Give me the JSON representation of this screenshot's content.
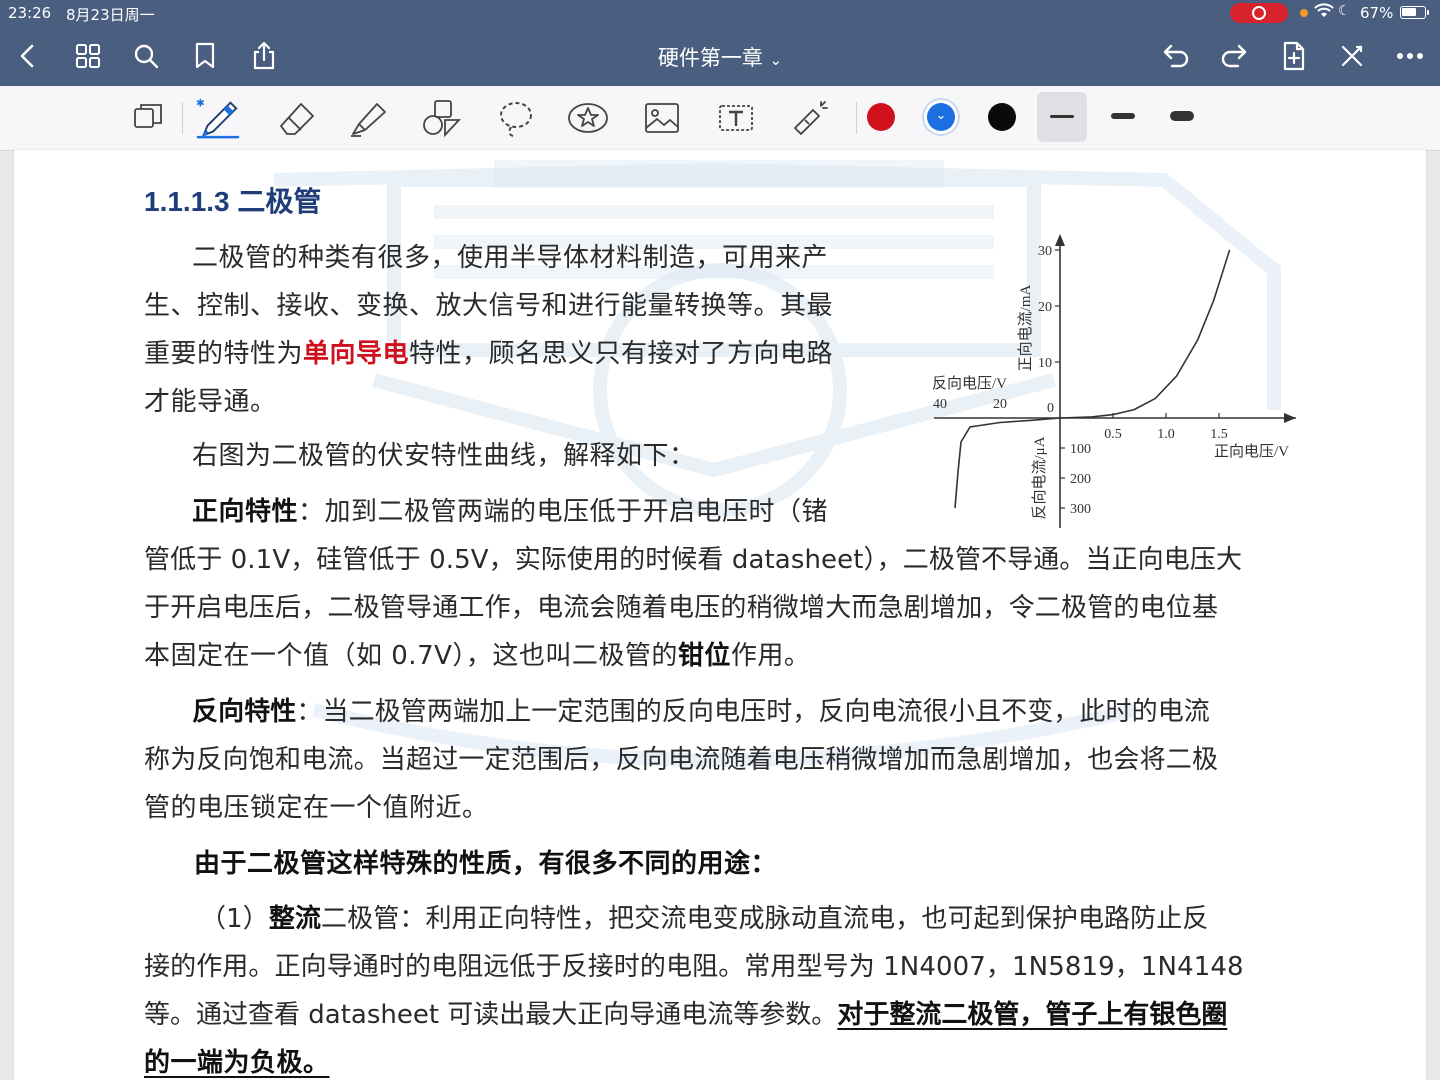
{
  "status_bar": {
    "time": "23:26",
    "date": "8月23日周一",
    "battery": "67%",
    "battery_level": 0.67
  },
  "nav": {
    "title": "硬件第一章"
  },
  "toolbar": {
    "tools": [
      "layout-icon",
      "pen-icon",
      "eraser-icon",
      "highlighter-icon",
      "shapes-icon",
      "lasso-icon",
      "sticker-icon",
      "image-icon",
      "text-icon",
      "laser-pointer-icon"
    ],
    "colors": [
      "#d0111b",
      "#1b6fe0",
      "#0a0a0a"
    ],
    "selected_color": "#1b6fe0",
    "stroke_widths": [
      "thin",
      "medium",
      "thick"
    ],
    "selected_stroke": "thin"
  },
  "doc": {
    "heading": "1.1.1.3 二极管",
    "p1": {
      "l1": "二极管的种类有很多，使用半导体材料制造，可用来产",
      "l2": "生、控制、接收、变换、放大信号和进行能量转换等。其最",
      "l3a": "重要的特性为",
      "l3b": "单向导电",
      "l3c": "特性，顾名思义只有接对了方向电路",
      "l4": "才能导通。"
    },
    "p2": "右图为二极管的伏安特性曲线，解释如下：",
    "p3": {
      "label": "正向特性",
      "l1": "：加到二极管两端的电压低于开启电压时（锗",
      "l2": "管低于 0.1V，硅管低于 0.5V，实际使用的时候看 datasheet），二极管不导通。当正向电压大",
      "l3": "于开启电压后，二极管导通工作，电流会随着电压的稍微增大而急剧增加，令二极管的电位基",
      "l4a": "本固定在一个值（如 0.7V），这也叫二极管的",
      "l4b": "钳位",
      "l4c": "作用。"
    },
    "p4": {
      "label": "反向特性",
      "l1": "：当二极管两端加上一定范围的反向电压时，反向电流很小且不变，此时的电流",
      "l2": "称为反向饱和电流。当超过一定范围后，反向电流随着电压稍微增加而急剧增加，也会将二极",
      "l3": "管的电压锁定在一个值附近。"
    },
    "p5": "由于二极管这样特殊的性质，有很多不同的用途：",
    "p6": {
      "l1a": "（1）",
      "l1b": "整流",
      "l1c": "二极管：利用正向特性，把交流电变成脉动直流电，也可起到保护电路防止反",
      "l2": "接的作用。正向导通时的电阻远低于反接时的电阻。常用型号为 1N4007，1N5819，1N4148",
      "l3a": "等。通过查看 datasheet 可读出最大正向导通电流等参数。",
      "l3b": "对于整流二极管，管子上有银色圈",
      "l4": "的一端为负极。"
    }
  },
  "chart_data": {
    "type": "line",
    "title": "",
    "xlabel_forward": "正向电压/V",
    "xlabel_reverse": "反向电压/V",
    "ylabel_forward": "正向电流/mA",
    "ylabel_reverse": "反向电流/μA",
    "x_ticks_forward": [
      "0.5",
      "1.0",
      "1.5"
    ],
    "x_ticks_reverse": [
      "40",
      "20"
    ],
    "y_ticks_forward": [
      "30",
      "20",
      "10"
    ],
    "y_ticks_reverse": [
      "100",
      "200",
      "300"
    ],
    "origin_label": "0",
    "series": [
      {
        "region": "forward",
        "x": [
          0,
          0.3,
          0.5,
          0.7,
          0.9,
          1.1,
          1.3,
          1.45,
          1.6
        ],
        "y": [
          0,
          0.2,
          0.6,
          1.5,
          3.5,
          7.5,
          14,
          21,
          30
        ]
      },
      {
        "region": "reverse",
        "x": [
          0,
          -10,
          -20,
          -30,
          -33,
          -34,
          -35
        ],
        "y": [
          0,
          -8,
          -15,
          -30,
          -80,
          -180,
          -300
        ]
      }
    ]
  }
}
